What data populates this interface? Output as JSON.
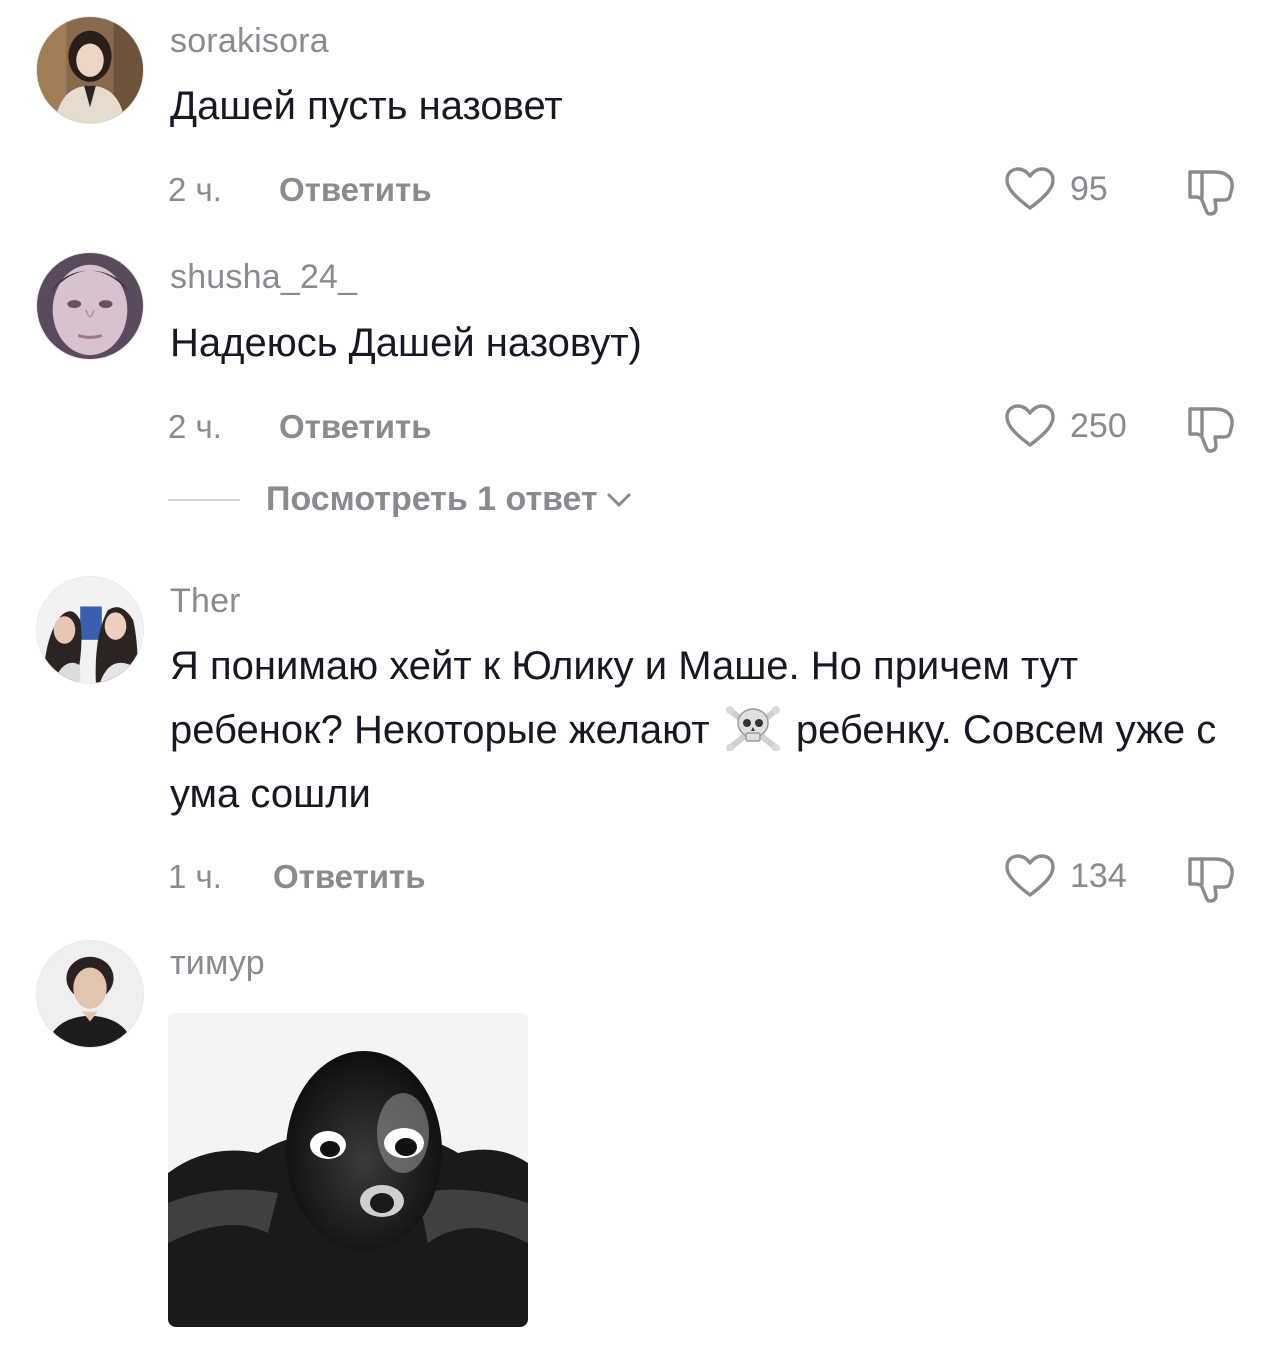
{
  "comments": [
    {
      "username": "sorakisora",
      "text": "Дашей пусть назовет",
      "time": "2 ч.",
      "reply_label": "Ответить",
      "likes": "95",
      "avatar_icon": "girl-portrait-avatar"
    },
    {
      "username": "shusha_24_",
      "text": "Надеюсь Дашей назовут)",
      "time": "2 ч.",
      "reply_label": "Ответить",
      "likes": "250",
      "view_replies": "Посмотреть 1 ответ",
      "avatar_icon": "face-closeup-avatar"
    },
    {
      "username": "Ther",
      "text_before_emoji": "Я понимаю хейт к Юлику и Маше. Но причем тут ребенок? Некоторые желают",
      "emoji": "skull-and-crossbones-emoji",
      "text_after_emoji": "ребенку. Совсем уже с ума сошли",
      "time": "1 ч.",
      "reply_label": "Ответить",
      "likes": "134",
      "avatar_icon": "two-girls-avatar"
    },
    {
      "username": "тимур",
      "avatar_icon": "boy-portrait-avatar",
      "image": "black-and-white-meme-face-image"
    }
  ],
  "colors": {
    "text_primary": "#161823",
    "text_secondary": "#8a8b91",
    "divider": "#d6d6d9",
    "background": "#ffffff"
  }
}
